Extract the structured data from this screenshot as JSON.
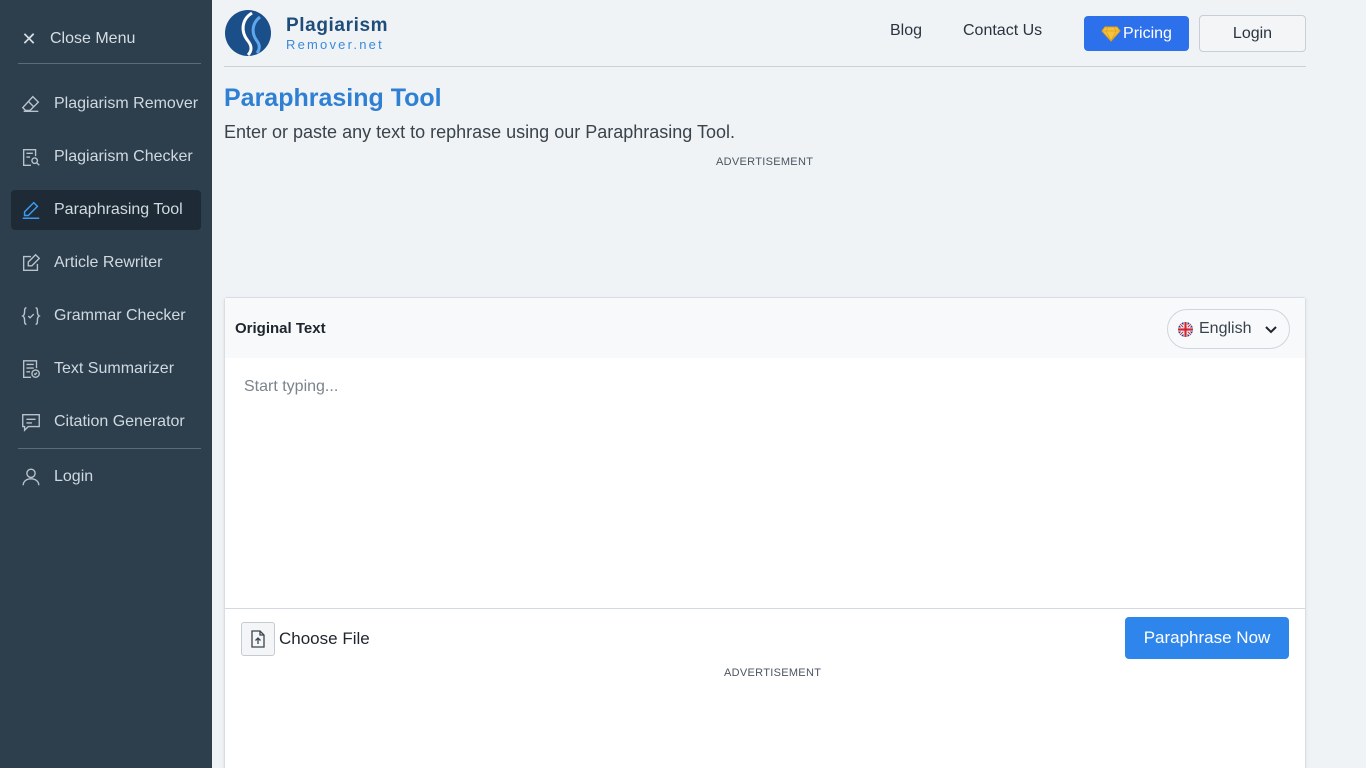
{
  "sidebar": {
    "close_label": "Close Menu",
    "items": [
      {
        "label": "Plagiarism Remover",
        "icon": "eraser-icon"
      },
      {
        "label": "Plagiarism Checker",
        "icon": "document-search-icon"
      },
      {
        "label": "Paraphrasing Tool",
        "icon": "pen-icon",
        "active": true
      },
      {
        "label": "Article Rewriter",
        "icon": "edit-document-icon"
      },
      {
        "label": "Grammar Checker",
        "icon": "brackets-check-icon"
      },
      {
        "label": "Text Summarizer",
        "icon": "list-check-icon"
      },
      {
        "label": "Citation Generator",
        "icon": "quote-bubble-icon"
      }
    ],
    "login_label": "Login"
  },
  "header": {
    "logo_name": "Plagiarism",
    "logo_sub": "Remover.net",
    "links": [
      "Blog",
      "Contact Us"
    ],
    "pricing_label": "Pricing",
    "pricing_icon": "diamond-icon",
    "login_label": "Login"
  },
  "page": {
    "title": "Paraphrasing Tool",
    "subtitle": "Enter or paste any text to rephrase using our Paraphrasing Tool.",
    "ad_label": "ADVERTISEMENT"
  },
  "editor": {
    "title": "Original Text",
    "language": "English",
    "placeholder": "Start typing...",
    "choose_file_label": "Choose File",
    "submit_label": "Paraphrase Now"
  },
  "colors": {
    "sidebar_bg": "#2d3e4c",
    "accent": "#2f7fd3",
    "pricing_bg": "#2c70eb",
    "submit_bg": "#2e86ec"
  }
}
